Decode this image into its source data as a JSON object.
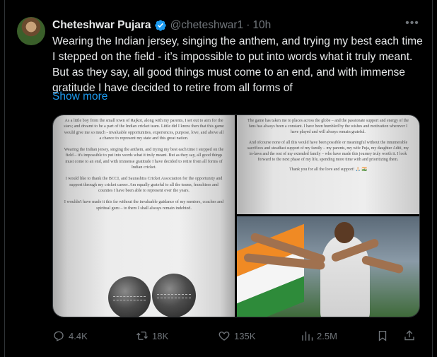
{
  "author": {
    "name": "Cheteshwar Pujara",
    "handle": "@cheteshwar1",
    "separator": "·",
    "time": "10h",
    "verified_icon": "verified-badge-icon",
    "verified_color": "#1d9bf0"
  },
  "tweet": {
    "text": "Wearing the Indian jersey, singing the anthem, and trying my best each time\nI stepped on the field - it’s impossible to put into words what it truly meant.\nBut as they say, all good things must come to an end, and with immense\ngratitude I have decided to retire from all forms of",
    "show_more": "Show more"
  },
  "media": {
    "letter_left": [
      "As a little boy from the small town of Rajkot, along with my parents, I set out to aim for the stars; and dreamt to be a part of the Indian cricket team. Little did I know then that this game would give me so much - invaluable opportunities, experiences, purpose, love, and above all a chance to represent my state and this great nation.",
      "Wearing the Indian jersey, singing the anthem, and trying my best each time I stepped on the field – it's impossible to put into words what it truly meant. But as they say, all good things must come to an end, and with immense gratitude I have decided to retire from all forms of Indian cricket.",
      "I would like to thank the BCCI, and Saurashtra Cricket Association for the opportunity and support through my cricket career. Am equally grateful to all the teams, franchises and counties I have been able to represent over the years.",
      "I wouldn't have made it this far without the invaluable guidance of my mentors, coaches and spiritual guru – to them I shall always remain indebted."
    ],
    "letter_right": [
      "The game has taken me to places across the globe – and the passionate support and energy of the fans has always been a constant. I have been humbled by the wishes and motivation wherever I have played and will always remain grateful.",
      "And ofcourse none of all this would have been possible or meaningful without the innumerable sacrifices and steadfast support of my family – my parents, my wife Puja, my daughter Aditi, my in-laws and the rest of my extended family – who have made this journey truly worth it. I look forward to the next phase of my life, spending more time with and prioritizing them.",
      "Thank you for all the love and support! 🙏🏻 🇮🇳"
    ]
  },
  "actions": {
    "replies": "4.4K",
    "retweets": "18K",
    "likes": "135K",
    "views": "2.5M"
  },
  "colors": {
    "background": "#000000",
    "text": "#e7e9ea",
    "muted": "#71767b",
    "accent": "#1d9bf0"
  }
}
